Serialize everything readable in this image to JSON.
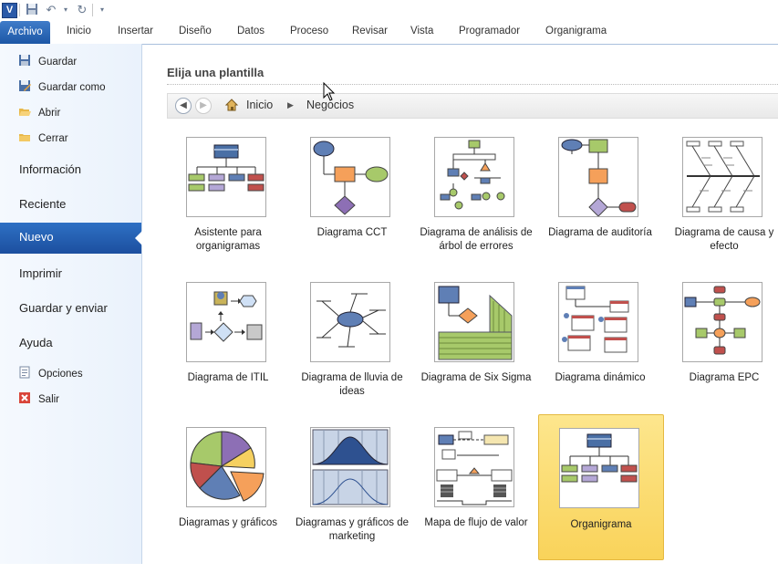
{
  "app": {
    "logo": "V"
  },
  "ribbon": {
    "file_tab": "Archivo",
    "tabs": [
      "Inicio",
      "Insertar",
      "Diseño",
      "Datos",
      "Proceso",
      "Revisar",
      "Vista",
      "Programador",
      "Organigrama"
    ]
  },
  "backstage": {
    "small_items_top": [
      "Guardar",
      "Guardar como",
      "Abrir",
      "Cerrar"
    ],
    "big_items": [
      "Información",
      "Reciente",
      "Nuevo",
      "Imprimir",
      "Guardar y enviar",
      "Ayuda"
    ],
    "selected": "Nuevo",
    "small_items_bottom": [
      "Opciones",
      "Salir"
    ]
  },
  "content": {
    "heading": "Elija una plantilla",
    "breadcrumb": [
      "Inicio",
      "Negocios"
    ]
  },
  "templates": [
    "Asistente para organigramas",
    "Diagrama CCT",
    "Diagrama de análisis de árbol de errores",
    "Diagrama de auditoría",
    "Diagrama de causa y efecto",
    "Diagrama de ITIL",
    "Diagrama de lluvia de ideas",
    "Diagrama de Six Sigma",
    "Diagrama dinámico",
    "Diagrama EPC",
    "Diagramas y gráficos",
    "Diagramas y gráficos de marketing",
    "Mapa de flujo de valor",
    "Organigrama"
  ],
  "selected_template": "Organigrama",
  "colors": {
    "accent": "#1d57a6",
    "selection": "#f9d35a",
    "shape_blue": "#4a6fa5",
    "shape_green": "#a7c96a",
    "shape_orange": "#f5a05a",
    "shape_purple": "#b4a7d6",
    "shape_red": "#c0504d"
  }
}
